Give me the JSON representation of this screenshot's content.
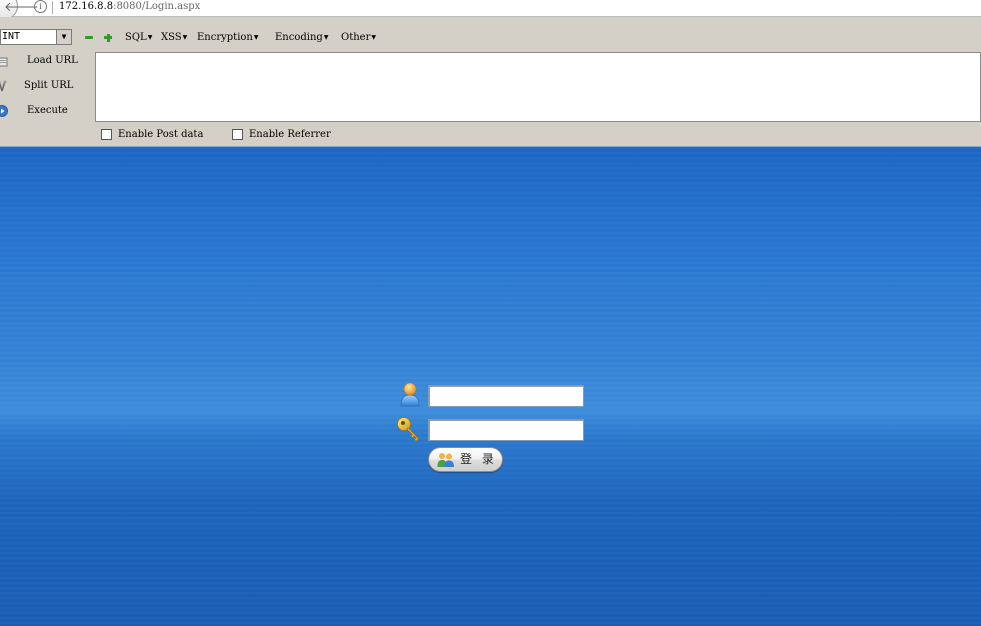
{
  "browser": {
    "url_host": "172.16.8.8",
    "url_rest": ":8080/Login.aspx"
  },
  "hackbar": {
    "select_value": "INT",
    "menus": [
      "SQL",
      "XSS",
      "Encryption",
      "Encoding",
      "Other"
    ],
    "buttons": {
      "load_url": "Load URL",
      "split_url": "Split URL",
      "execute": "Execute"
    },
    "textarea_value": "",
    "checkboxes": {
      "post_data": "Enable Post data",
      "referrer": "Enable Referrer"
    }
  },
  "login": {
    "username_value": "",
    "password_value": "",
    "submit_label": "登 录"
  },
  "colors": {
    "toolbar_bg": "#d4d0c8",
    "page_blue": "#2a79d2"
  }
}
